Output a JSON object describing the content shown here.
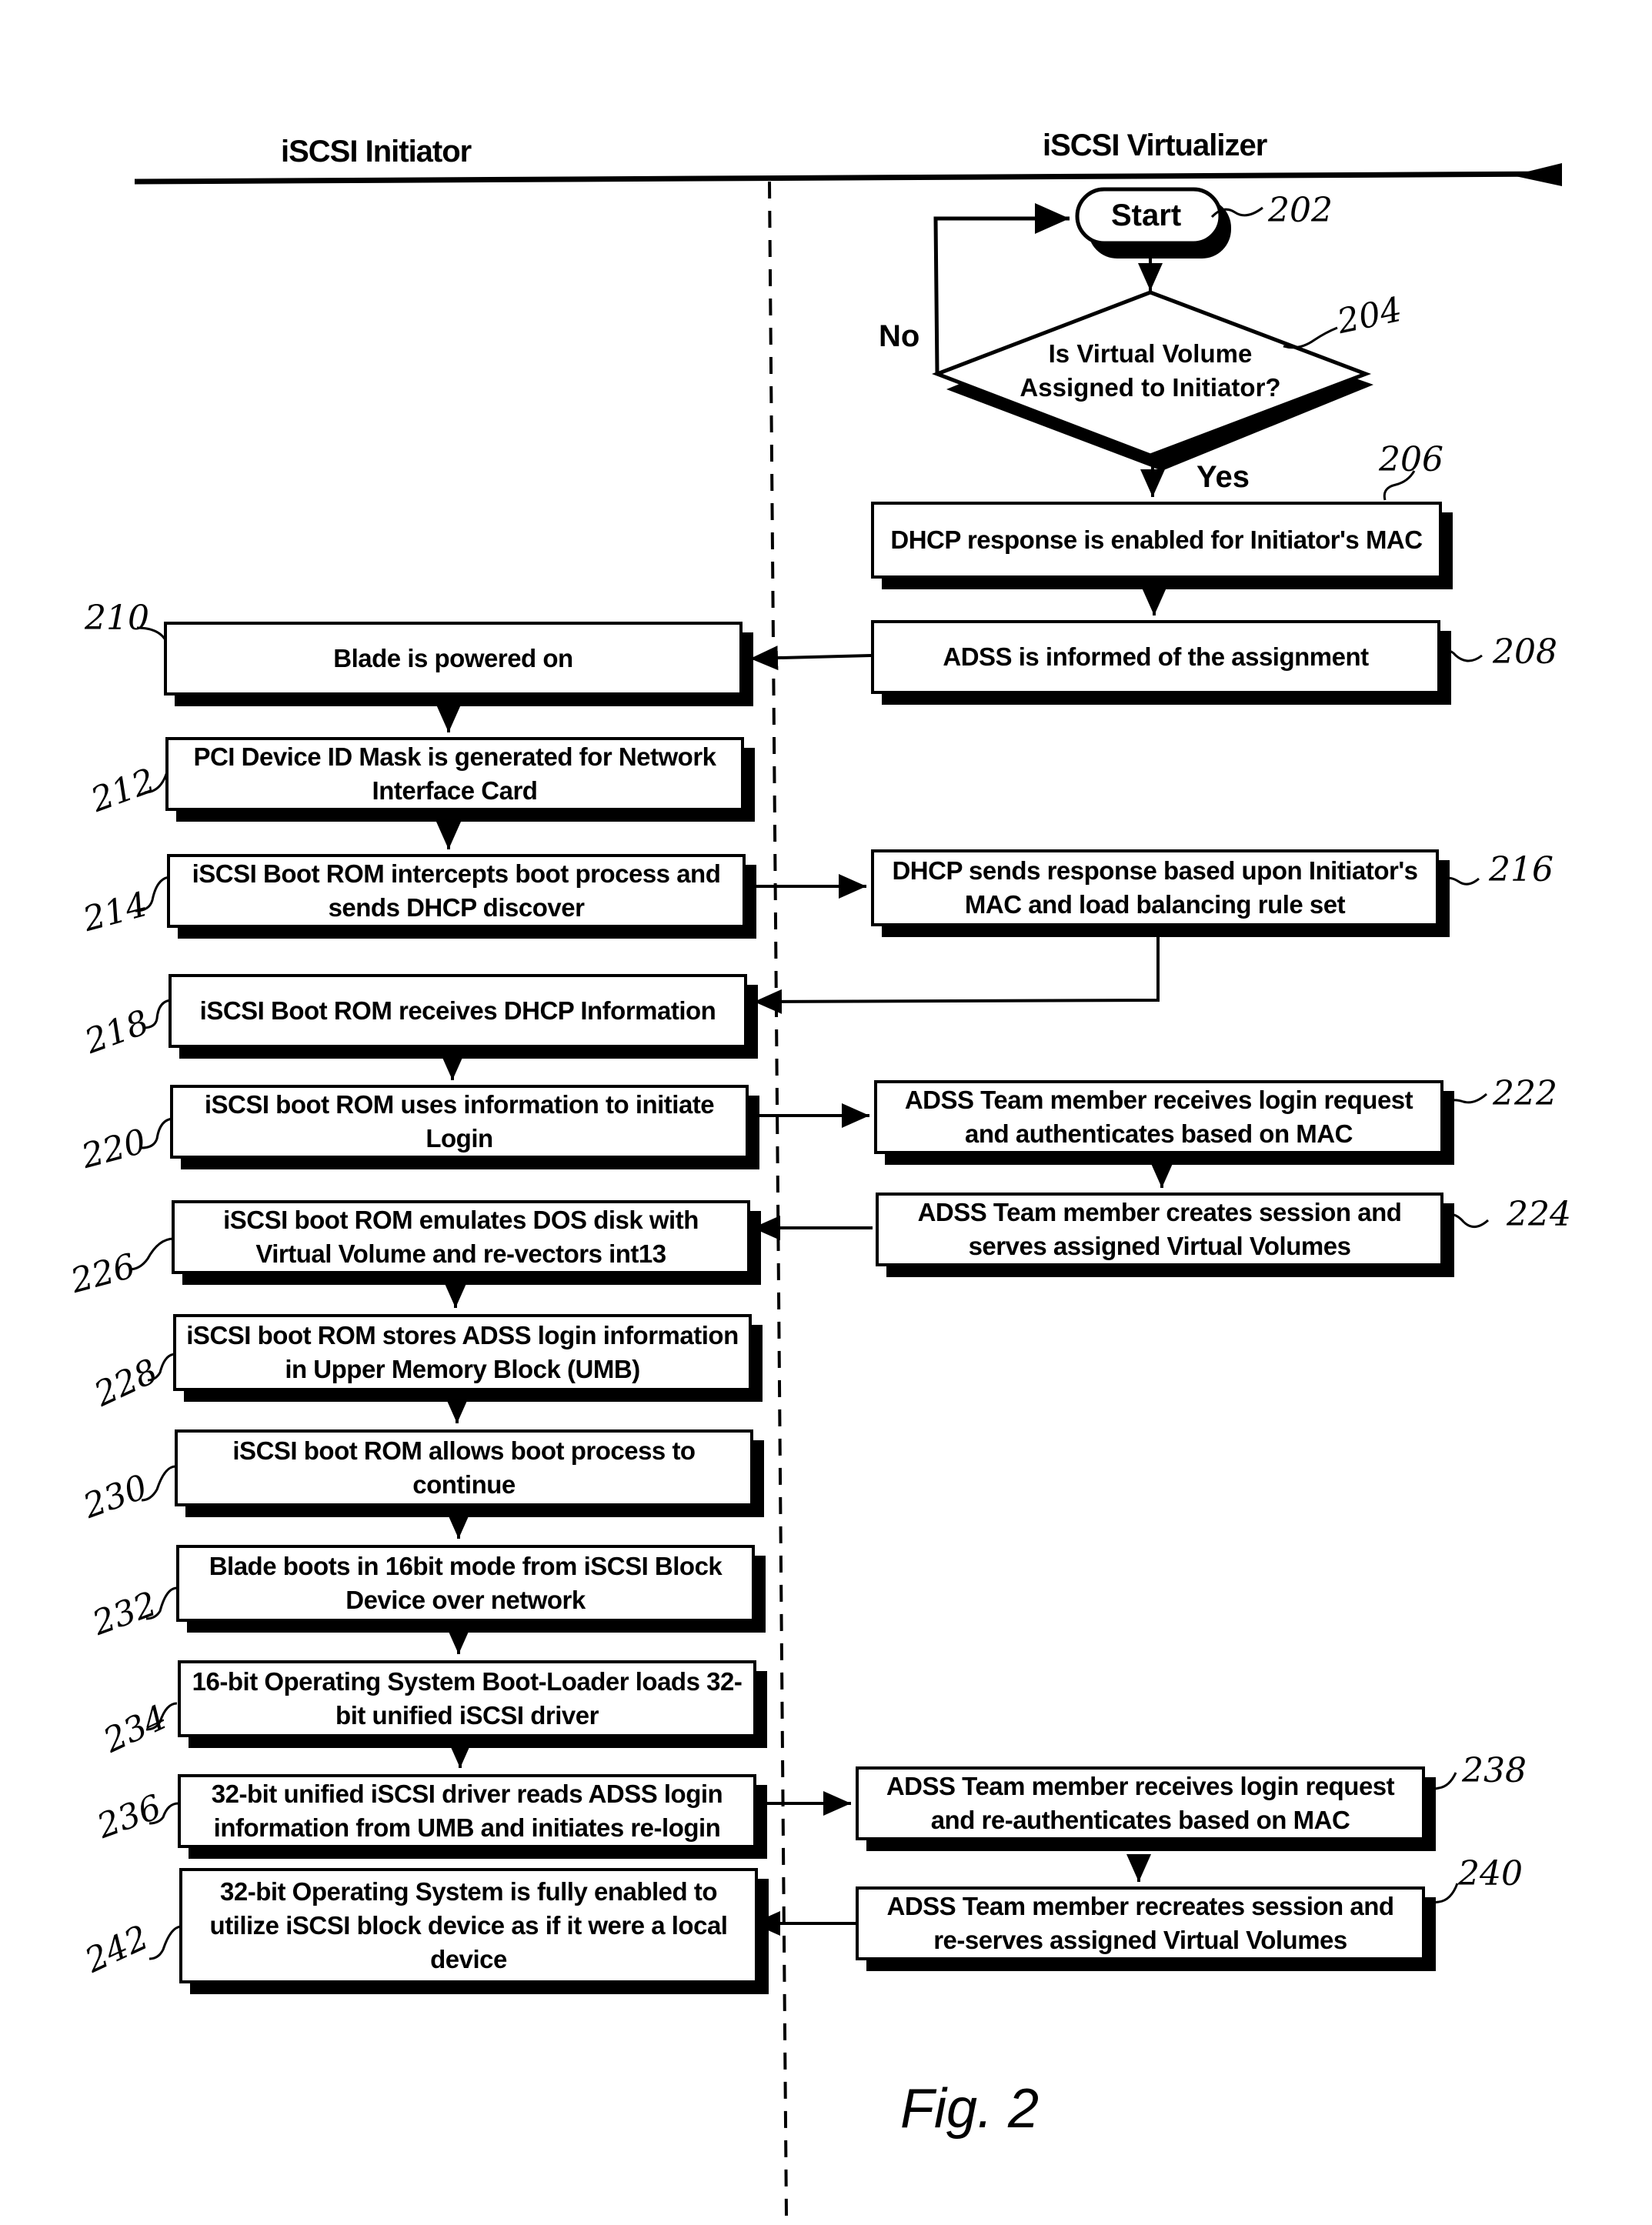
{
  "lanes": {
    "left": "iSCSI Initiator",
    "right": "iSCSI Virtualizer"
  },
  "start": {
    "label": "Start",
    "ref": "202"
  },
  "decision": {
    "text_line1": "Is Virtual Volume",
    "text_line2": "Assigned to Initiator?",
    "ref": "204",
    "no_label": "No",
    "yes_label": "Yes"
  },
  "steps": {
    "s206": {
      "text": "DHCP response is enabled for Initiator's MAC",
      "ref": "206"
    },
    "s208": {
      "text": "ADSS is informed of the assignment",
      "ref": "208"
    },
    "s210": {
      "text": "Blade is powered on",
      "ref": "210"
    },
    "s212": {
      "text": "PCI Device ID Mask is generated for Network Interface Card",
      "ref": "212"
    },
    "s214": {
      "text": "iSCSI Boot ROM intercepts boot process and sends DHCP discover",
      "ref": "214"
    },
    "s216": {
      "text": "DHCP sends response based upon Initiator's MAC and load balancing rule set",
      "ref": "216"
    },
    "s218": {
      "text": "iSCSI Boot ROM receives DHCP Information",
      "ref": "218"
    },
    "s220": {
      "text": "iSCSI boot ROM uses information to initiate Login",
      "ref": "220"
    },
    "s222": {
      "text": "ADSS Team member receives login request and authenticates based on MAC",
      "ref": "222"
    },
    "s224": {
      "text": "ADSS Team member creates session and serves assigned Virtual Volumes",
      "ref": "224"
    },
    "s226": {
      "text": "iSCSI boot ROM emulates DOS disk with Virtual Volume and re-vectors int13",
      "ref": "226"
    },
    "s228": {
      "text": "iSCSI boot ROM stores ADSS login information in Upper Memory Block (UMB)",
      "ref": "228"
    },
    "s230": {
      "text": "iSCSI boot ROM allows boot process to continue",
      "ref": "230"
    },
    "s232": {
      "text": "Blade boots in 16bit mode from iSCSI Block Device over network",
      "ref": "232"
    },
    "s234": {
      "text": "16-bit Operating System Boot-Loader loads 32-bit unified iSCSI driver",
      "ref": "234"
    },
    "s236": {
      "text": "32-bit unified iSCSI driver reads ADSS login information from UMB and initiates re-login",
      "ref": "236"
    },
    "s238": {
      "text": "ADSS Team member receives login request and re-authenticates based on MAC",
      "ref": "238"
    },
    "s240": {
      "text": "ADSS Team member recreates session and re-serves assigned Virtual Volumes",
      "ref": "240"
    },
    "s242": {
      "text": "32-bit Operating System is fully enabled to utilize iSCSI block device as if it were a local device",
      "ref": "242"
    }
  },
  "figure_label": "Fig. 2"
}
